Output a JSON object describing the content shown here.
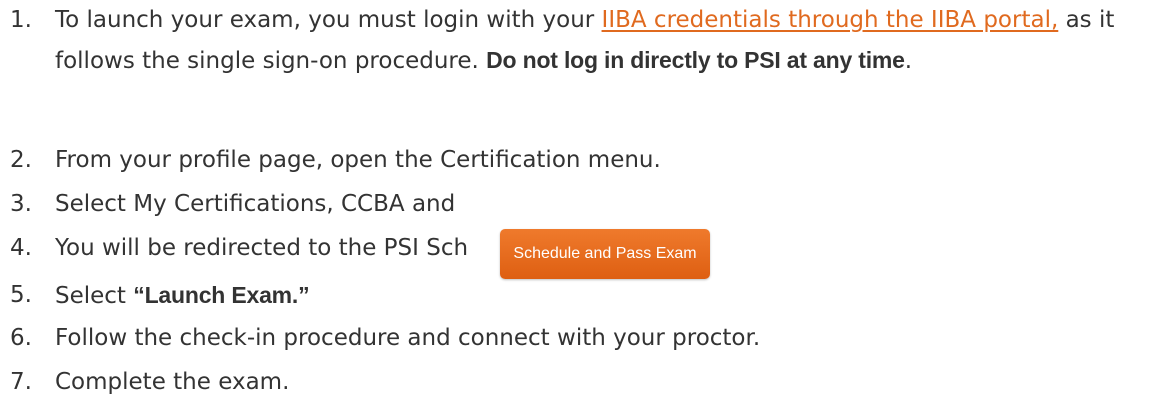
{
  "steps": [
    {
      "number": "1.",
      "text_before": "To launch your exam, you must login with your ",
      "link_text": "IIBA credentials through the IIBA portal,",
      "text_after": " as it follows the single sign-on procedure.  ",
      "bold": "Do not log in directly to PSI at any time",
      "tail": "."
    },
    {
      "number": "2.",
      "text": "From your profile page, open the Certification menu."
    },
    {
      "number": "3.",
      "text": "Select My Certifications, CCBA and"
    },
    {
      "number": "4.",
      "text": "You will be redirected to the PSI Sch"
    },
    {
      "number": "5.",
      "text": "Select ",
      "bold": "“Launch Exam.”"
    },
    {
      "number": "6.",
      "text": "Follow the check-in procedure and connect with your proctor."
    },
    {
      "number": "7.",
      "text": "Complete the exam."
    }
  ],
  "button": {
    "label": "Schedule and Pass Exam",
    "color": "#e8702a"
  },
  "colors": {
    "link": "#e06a1f",
    "text": "#333333"
  }
}
